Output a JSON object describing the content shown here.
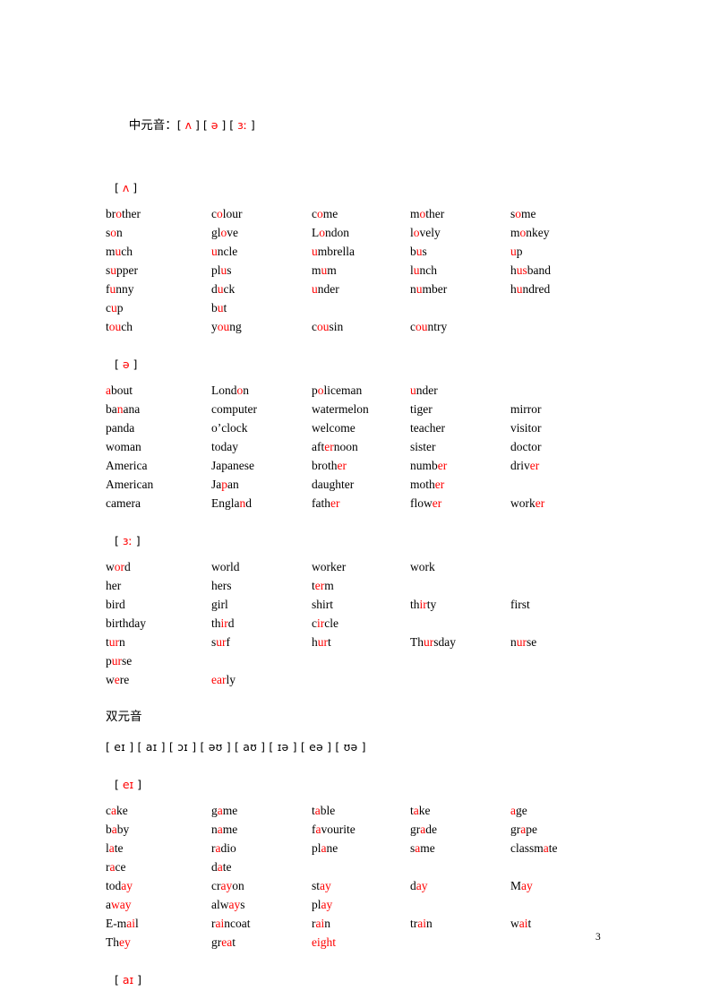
{
  "document": {
    "page_number": "3",
    "red_hex": "#FF0000",
    "black_hex": "#000000"
  },
  "mid_vowels_heading": {
    "label_cn": "中元音：",
    "symbols": "[ ʌ ] [ ə ] [ ɜː ]",
    "symbol_list": [
      "[ ʌ ]",
      "[ ə ]",
      "[ ɜː ]"
    ]
  },
  "sections": [
    {
      "id": "section-ipa-caret",
      "symbol": "[ ʌ ]",
      "rows": [
        [
          {
            "text": "brother",
            "red": [
              2,
              3
            ]
          },
          {
            "text": "colour",
            "red": [
              1,
              2
            ]
          },
          {
            "text": "come",
            "red": [
              1,
              2
            ]
          },
          {
            "text": "mother",
            "red": [
              1,
              2
            ]
          },
          {
            "text": "some",
            "red": [
              1,
              2
            ]
          }
        ],
        [
          {
            "text": "son",
            "red": [
              1,
              2
            ]
          },
          {
            "text": "glove",
            "red": [
              2,
              3
            ]
          },
          {
            "text": "London",
            "red": [
              1,
              2
            ]
          },
          {
            "text": "lovely",
            "red": [
              1,
              2
            ]
          },
          {
            "text": "monkey",
            "red": [
              1,
              2
            ]
          }
        ],
        [
          {
            "text": "much",
            "red": [
              1,
              2
            ]
          },
          {
            "text": "uncle",
            "red": [
              0,
              1
            ]
          },
          {
            "text": "umbrella",
            "red": [
              0,
              1
            ]
          },
          {
            "text": "bus",
            "red": [
              1,
              2
            ]
          },
          {
            "text": "up",
            "red": [
              0,
              1
            ]
          }
        ],
        [
          {
            "text": "supper",
            "red": [
              1,
              2
            ]
          },
          {
            "text": "plus",
            "red": [
              2,
              3
            ]
          },
          {
            "text": "mum",
            "red": [
              1,
              2
            ]
          },
          {
            "text": "lunch",
            "red": [
              1,
              2
            ]
          },
          {
            "text": "husband",
            "red": [
              1,
              3
            ]
          }
        ],
        [
          {
            "text": "funny",
            "red": [
              1,
              2
            ]
          },
          {
            "text": "duck",
            "red": [
              1,
              2
            ]
          },
          {
            "text": "under",
            "red": [
              0,
              1
            ]
          },
          {
            "text": "number",
            "red": [
              1,
              2
            ]
          },
          {
            "text": "hundred",
            "red": [
              1,
              2
            ]
          }
        ],
        [
          {
            "text": "cup",
            "red": [
              1,
              2
            ]
          },
          {
            "text": "but",
            "red": [
              1,
              2
            ]
          },
          {
            "text": "",
            "red": []
          },
          {
            "text": "",
            "red": []
          },
          {
            "text": "",
            "red": []
          }
        ],
        [
          {
            "text": "touch",
            "red": [
              1,
              3
            ]
          },
          {
            "text": "young",
            "red": [
              1,
              3
            ]
          },
          {
            "text": "cousin",
            "red": [
              1,
              3
            ]
          },
          {
            "text": "country",
            "red": [
              1,
              3
            ]
          },
          {
            "text": "",
            "red": []
          }
        ]
      ]
    },
    {
      "id": "section-ipa-schwa",
      "symbol": "[ ə ]",
      "rows": [
        [
          {
            "text": "about",
            "red": [
              0,
              1
            ]
          },
          {
            "text": "London",
            "red": [
              4,
              5
            ]
          },
          {
            "text": "policeman",
            "red": [
              1,
              2
            ]
          },
          {
            "text": "under",
            "red": [
              0,
              1
            ]
          },
          {
            "text": "",
            "red": []
          }
        ],
        [
          {
            "text": "banana",
            "red": [
              2,
              3
            ]
          },
          {
            "text": "computer",
            "red": []
          },
          {
            "text": "watermelon",
            "red": []
          },
          {
            "text": "tiger",
            "red": []
          },
          {
            "text": "mirror",
            "red": []
          }
        ],
        [
          {
            "text": "panda",
            "red": []
          },
          {
            "text": "o’clock",
            "red": []
          },
          {
            "text": "welcome",
            "red": []
          },
          {
            "text": "teacher",
            "red": []
          },
          {
            "text": "visitor",
            "red": []
          }
        ],
        [
          {
            "text": "woman",
            "red": []
          },
          {
            "text": "today",
            "red": []
          },
          {
            "text": "afternoon",
            "red": [
              3,
              5
            ]
          },
          {
            "text": "sister",
            "red": []
          },
          {
            "text": "doctor",
            "red": []
          }
        ],
        [
          {
            "text": "America",
            "red": []
          },
          {
            "text": "Japanese",
            "red": []
          },
          {
            "text": "brother",
            "red": [
              5,
              7
            ]
          },
          {
            "text": "number",
            "red": [
              4,
              6
            ]
          },
          {
            "text": "driver",
            "red": [
              4,
              6
            ]
          }
        ],
        [
          {
            "text": "American",
            "red": []
          },
          {
            "text": "Japan",
            "red": [
              2,
              3
            ]
          },
          {
            "text": "daughter",
            "red": []
          },
          {
            "text": "mother",
            "red": [
              4,
              6
            ]
          },
          {
            "text": "",
            "red": []
          }
        ],
        [
          {
            "text": "camera",
            "red": []
          },
          {
            "text": "England",
            "red": [
              5,
              6
            ]
          },
          {
            "text": "father",
            "red": [
              4,
              6
            ]
          },
          {
            "text": "flower",
            "red": [
              4,
              6
            ]
          },
          {
            "text": "worker",
            "red": [
              4,
              6
            ]
          }
        ]
      ]
    },
    {
      "id": "section-ipa-nurse",
      "symbol": "[ ɜː ]",
      "rows": [
        [
          {
            "text": "word",
            "red": [
              1,
              3
            ]
          },
          {
            "text": "world",
            "red": []
          },
          {
            "text": "worker",
            "red": []
          },
          {
            "text": "work",
            "red": []
          },
          {
            "text": "",
            "red": []
          }
        ],
        [
          {
            "text": "her",
            "red": []
          },
          {
            "text": "hers",
            "red": []
          },
          {
            "text": "term",
            "red": [
              1,
              3
            ]
          },
          {
            "text": "",
            "red": []
          },
          {
            "text": "",
            "red": []
          }
        ],
        [
          {
            "text": "bird",
            "red": []
          },
          {
            "text": "girl",
            "red": []
          },
          {
            "text": "shirt",
            "red": []
          },
          {
            "text": "thirty",
            "red": [
              2,
              4
            ]
          },
          {
            "text": "first",
            "red": []
          }
        ],
        [
          {
            "text": "birthday",
            "red": []
          },
          {
            "text": "third",
            "red": [
              2,
              4
            ]
          },
          {
            "text": "circle",
            "red": [
              1,
              3
            ]
          },
          {
            "text": "",
            "red": []
          },
          {
            "text": "",
            "red": []
          }
        ],
        [
          {
            "text": "turn",
            "red": [
              1,
              3
            ]
          },
          {
            "text": "surf",
            "red": [
              1,
              3
            ]
          },
          {
            "text": "hurt",
            "red": [
              1,
              3
            ]
          },
          {
            "text": "Thursday",
            "red": [
              2,
              4
            ]
          },
          {
            "text": "nurse",
            "red": [
              1,
              3
            ]
          }
        ],
        [
          {
            "text": "purse",
            "red": [
              1,
              3
            ]
          },
          {
            "text": "",
            "red": []
          },
          {
            "text": "",
            "red": []
          },
          {
            "text": "",
            "red": []
          },
          {
            "text": "",
            "red": []
          }
        ],
        [
          {
            "text": "were",
            "red": [
              1,
              2
            ]
          },
          {
            "text": "early",
            "red": [
              0,
              3
            ]
          },
          {
            "text": "",
            "red": []
          },
          {
            "text": "",
            "red": []
          },
          {
            "text": "",
            "red": []
          }
        ]
      ]
    }
  ],
  "diphthong_heading": {
    "label_cn": "双元音",
    "symbols": "[ eɪ ] [ aɪ ] [ ɔɪ ] [ əʊ ] [ aʊ ] [ ɪə ] [ eə ] [ ʊə ]",
    "symbol_list": [
      "[ eɪ ]",
      "[ aɪ ]",
      "[ ɔɪ ]",
      "[ əʊ ]",
      "[ aʊ ]",
      "[ ɪə ]",
      "[ eə ]",
      "[ ʊə ]"
    ]
  },
  "diphthong_sections": [
    {
      "id": "section-ipa-face",
      "symbol": "[ eɪ ]",
      "rows": [
        [
          {
            "text": "cake",
            "red": [
              1,
              2
            ]
          },
          {
            "text": "game",
            "red": [
              1,
              2
            ]
          },
          {
            "text": "table",
            "red": [
              1,
              2
            ]
          },
          {
            "text": "take",
            "red": [
              1,
              2
            ]
          },
          {
            "text": "age",
            "red": [
              0,
              1
            ]
          }
        ],
        [
          {
            "text": "baby",
            "red": [
              1,
              2
            ]
          },
          {
            "text": "name",
            "red": [
              1,
              2
            ]
          },
          {
            "text": "favourite",
            "red": [
              1,
              2
            ]
          },
          {
            "text": "grade",
            "red": [
              2,
              3
            ]
          },
          {
            "text": "grape",
            "red": [
              2,
              3
            ]
          }
        ],
        [
          {
            "text": "late",
            "red": [
              1,
              2
            ]
          },
          {
            "text": "radio",
            "red": [
              1,
              2
            ]
          },
          {
            "text": "plane",
            "red": [
              2,
              3
            ]
          },
          {
            "text": "same",
            "red": [
              1,
              2
            ]
          },
          {
            "text": "classmate",
            "red": [
              6,
              7
            ]
          }
        ],
        [
          {
            "text": "race",
            "red": [
              1,
              2
            ]
          },
          {
            "text": "date",
            "red": [
              1,
              2
            ]
          },
          {
            "text": "",
            "red": []
          },
          {
            "text": "",
            "red": []
          },
          {
            "text": "",
            "red": []
          }
        ],
        [
          {
            "text": "today",
            "red": [
              3,
              5
            ]
          },
          {
            "text": "crayon",
            "red": [
              2,
              4
            ]
          },
          {
            "text": "stay",
            "red": [
              2,
              4
            ]
          },
          {
            "text": "day",
            "red": [
              1,
              3
            ]
          },
          {
            "text": "May",
            "red": [
              1,
              3
            ]
          }
        ],
        [
          {
            "text": "away",
            "red": [
              1,
              4
            ]
          },
          {
            "text": "always",
            "red": [
              3,
              5
            ]
          },
          {
            "text": "play",
            "red": [
              2,
              4
            ]
          },
          {
            "text": "",
            "red": []
          },
          {
            "text": "",
            "red": []
          }
        ],
        [
          {
            "text": "E-mail",
            "red": [
              3,
              5
            ]
          },
          {
            "text": "raincoat",
            "red": [
              1,
              3
            ]
          },
          {
            "text": "rain",
            "red": [
              1,
              3
            ]
          },
          {
            "text": "train",
            "red": [
              2,
              4
            ]
          },
          {
            "text": "wait",
            "red": [
              1,
              3
            ]
          }
        ],
        [
          {
            "text": "They",
            "red": [
              2,
              4
            ]
          },
          {
            "text": "great",
            "red": [
              2,
              4
            ]
          },
          {
            "text": "eight",
            "red": [
              0,
              5
            ]
          },
          {
            "text": "",
            "red": []
          },
          {
            "text": "",
            "red": []
          }
        ]
      ]
    },
    {
      "id": "section-ipa-price",
      "symbol": "[ aɪ ]",
      "rows": []
    }
  ]
}
